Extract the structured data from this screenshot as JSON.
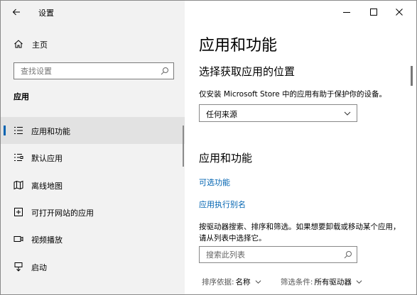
{
  "window": {
    "title": "设置"
  },
  "sidebar": {
    "home_label": "主页",
    "search_placeholder": "查找设置",
    "section_heading": "应用",
    "items": [
      {
        "label": "应用和功能",
        "icon": "apps-list-icon",
        "active": true
      },
      {
        "label": "默认应用",
        "icon": "default-apps-icon",
        "active": false
      },
      {
        "label": "离线地图",
        "icon": "offline-maps-icon",
        "active": false
      },
      {
        "label": "可打开网站的应用",
        "icon": "website-apps-icon",
        "active": false
      },
      {
        "label": "视频播放",
        "icon": "video-playback-icon",
        "active": false
      },
      {
        "label": "启动",
        "icon": "startup-icon",
        "active": false
      }
    ]
  },
  "main": {
    "title": "应用和功能",
    "install_section": {
      "title": "选择获取应用的位置",
      "description": "仅安装 Microsoft Store 中的应用有助于保护你的设备。",
      "dropdown_value": "任何来源"
    },
    "apps_section": {
      "title": "应用和功能",
      "link_optional_features": "可选功能",
      "link_app_aliases": "应用执行别名",
      "description": "按驱动器搜索、排序和筛选。如果想要卸载或移动某个应用，请从列表中选择它。",
      "search_placeholder": "搜索此列表",
      "sort_label": "排序依据:",
      "sort_value": "名称",
      "filter_label": "筛选条件:",
      "filter_value": "所有驱动器"
    }
  },
  "colors": {
    "accent": "#0063b1",
    "sidebar_bg": "#f2f2f2",
    "active_bg": "#e2e2e2"
  }
}
